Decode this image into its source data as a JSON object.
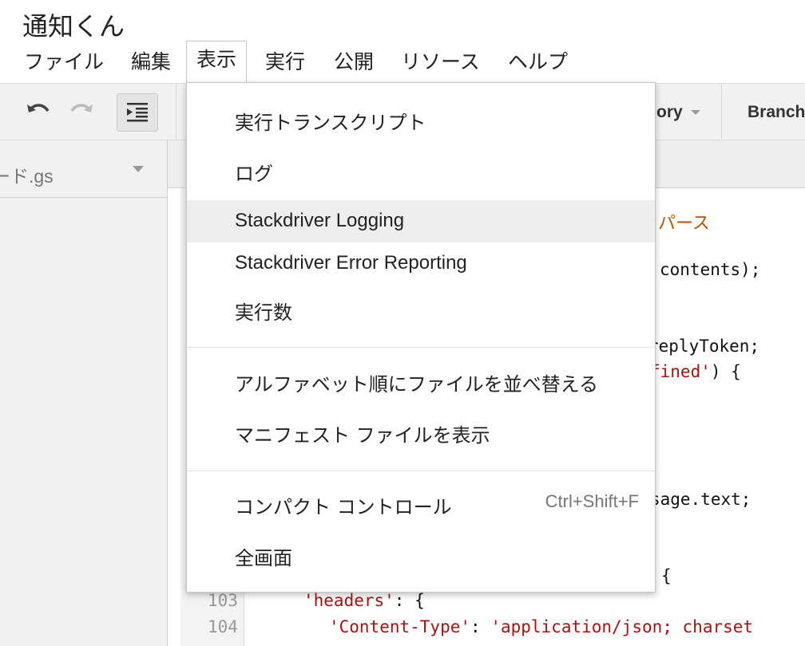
{
  "app": {
    "title": "通知くん"
  },
  "menubar": {
    "items": [
      "ファイル",
      "編集",
      "表示",
      "実行",
      "公開",
      "リソース",
      "ヘルプ"
    ]
  },
  "toolbar": {
    "history_label": "ory",
    "branch_label": "Branch"
  },
  "file_panel": {
    "file_name": "ード.gs"
  },
  "editor": {
    "lines": [
      {
        "number": "103",
        "code": "'headers': {"
      },
      {
        "number": "104",
        "code": "'Content-Type': 'application/json; charset"
      }
    ],
    "visible_fragments": {
      "comment": "をパース",
      "contents": "contents);",
      "reply_token": "replyToken;",
      "fined": "fined') {",
      "sage_text": "sage.text;",
      "brace": "{"
    }
  },
  "dropdown": {
    "items": [
      {
        "label": "実行トランスクリプト"
      },
      {
        "label": "ログ"
      },
      {
        "label": "Stackdriver Logging",
        "highlighted": true
      },
      {
        "label": "Stackdriver Error Reporting"
      },
      {
        "label": "実行数"
      },
      {
        "label": "アルファベット順にファイルを並べ替える"
      },
      {
        "label": "マニフェスト ファイルを表示"
      },
      {
        "label": "コンパクト コントロール",
        "shortcut": "Ctrl+Shift+F"
      },
      {
        "label": "全画面"
      }
    ]
  }
}
